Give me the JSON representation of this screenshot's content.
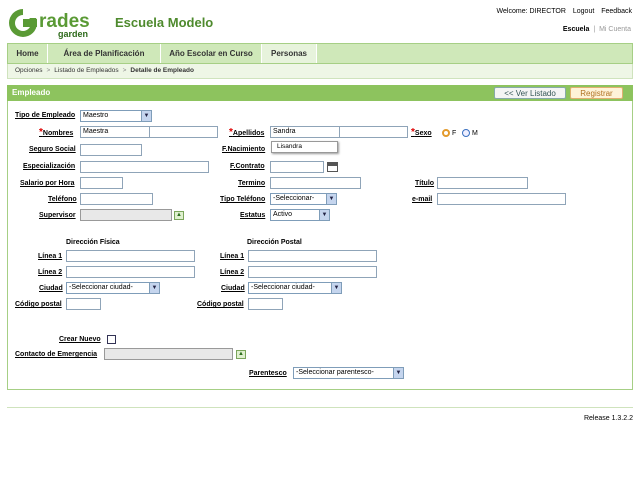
{
  "header": {
    "logo_text": "Grades garden",
    "school_name": "Escuela Modelo",
    "welcome": "Welcome: DIRECTOR",
    "logout": "Logout",
    "feedback": "Feedback",
    "link_school": "Escuela",
    "link_separator": "|",
    "link_account": "Mi Cuenta"
  },
  "nav": {
    "tabs": [
      {
        "label": "Home"
      },
      {
        "label": "Área de Planificación"
      },
      {
        "label": "Año Escolar en Curso"
      },
      {
        "label": "Personas"
      }
    ]
  },
  "breadcrumb": [
    "Opciones",
    "Listado de Empleados",
    "Detalle de Empleado"
  ],
  "breadcrumb_sep": ">",
  "panel": {
    "title": "Empleado",
    "back_label": "<< Ver Listado",
    "register_label": "Registrar"
  },
  "form": {
    "tipo_empleado_label": "Tipo de Empleado",
    "tipo_empleado_value": "Maestro",
    "required_mark": "*",
    "nombres_label": "Nombres",
    "nombres_value": "Maestra",
    "apellidos_label": "Apellidos",
    "apellidos_value": "Sandra",
    "apellidos_suggestion": "Lisandra",
    "sexo_label": "Sexo",
    "sexo_f": "F",
    "sexo_m": "M",
    "seguro_social_label": "Seguro Social",
    "f_nacimiento_label": "F.Nacimiento",
    "especializacion_label": "Especialización",
    "f_contrato_label": "F.Contrato",
    "salario_label": "Salario por Hora",
    "termino_label": "Termino",
    "titulo_label": "Título",
    "telefono_label": "Teléfono",
    "tipo_telefono_label": "Tipo Teléfono",
    "tipo_telefono_value": "-Seleccionar-",
    "email_label": "e-mail",
    "supervisor_label": "Supervisor",
    "estatus_label": "Estatus",
    "estatus_value": "Activo",
    "direccion_fisica_title": "Dirección Física",
    "direccion_postal_title": "Dirección Postal",
    "linea1_label": "Línea 1",
    "linea2_label": "Línea 2",
    "ciudad_label": "Ciudad",
    "ciudad_value": "-Seleccionar ciudad-",
    "codigo_postal_label": "Código postal",
    "crear_nuevo_label": "Crear Nuevo",
    "contacto_label": "Contacto de Emergencia",
    "parentesco_label": "Parentesco",
    "parentesco_value": "-Seleccionar parentesco-"
  },
  "footer": {
    "release": "Release 1.3.2.2"
  },
  "colors": {
    "accent_green": "#8dc35e",
    "nav_bg": "#cfe8b9",
    "required_red": "#dd0000"
  },
  "icons": [
    "calendar-icon",
    "arrow-up-icon",
    "dropdown-arrow-icon"
  ]
}
